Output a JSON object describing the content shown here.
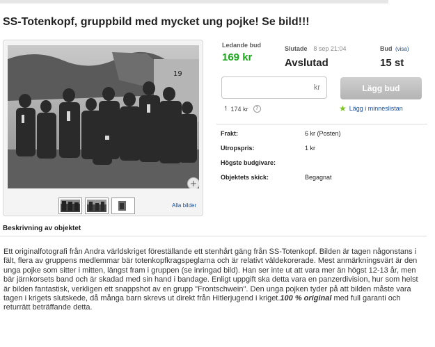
{
  "listing": {
    "title": "SS-Totenkopf, gruppbild med mycket ung pojke! Se bild!!!"
  },
  "gallery": {
    "zoom_icon": "magnifier-plus-icon",
    "thumbnail_count": 3,
    "all_images_link": "Alla bilder"
  },
  "bidding": {
    "leading_bid_label": "Ledande bud",
    "leading_bid_value": "169 kr",
    "ends_label": "Slutade",
    "ends_date": "8 sep 21:04",
    "status_value": "Avslutad",
    "bids_label": "Bud",
    "bids_link": "(visa)",
    "bids_value": "15 st",
    "input_value": "",
    "input_unit": "kr",
    "place_bid_button": "Lägg bud",
    "history_icon": "arrow-up-icon",
    "history_value": "174 kr",
    "help_icon": "?",
    "watchlist_icon": "star-icon",
    "watchlist_label": "Lägg i minneslistan"
  },
  "details": [
    {
      "key": "Frakt:",
      "value": "6 kr (Posten)"
    },
    {
      "key": "Utropspris:",
      "value": "1 kr"
    },
    {
      "key": "Högste budgivare:",
      "value": ""
    },
    {
      "key": "Objektets skick:",
      "value": "Begagnat"
    }
  ],
  "description": {
    "heading": "Beskrivning av objektet",
    "body": "Ett originalfotografi från Andra världskriget föreställande ett stenhårt gäng från SS-Totenkopf. Bilden är tagen någonstans i fält, flera av gruppens medlemmar bär totenkopfkragspeglarna och är relativt väldekorerade. Mest anmärkningsvärt är den unga pojke som sitter i mitten, längst fram i gruppen (se inringad bild). Han ser inte ut att vara mer än högst 12-13 år, men bär järnkorsets band och är skadad med sin hand i bandage. Enligt uppgift ska detta vara en panzerdivision, hur som helst är bilden fantastisk, verkligen ett snappshot av en grupp \"Frontschwein\". Den unga pojken tyder på att bilden måste vara tagen i krigets slutskede, då många barn skrevs ut direkt från Hitlerjugend i kriget.",
    "emphasis": "100 % original",
    "tail": " med full garanti och returrätt beträffande detta."
  }
}
